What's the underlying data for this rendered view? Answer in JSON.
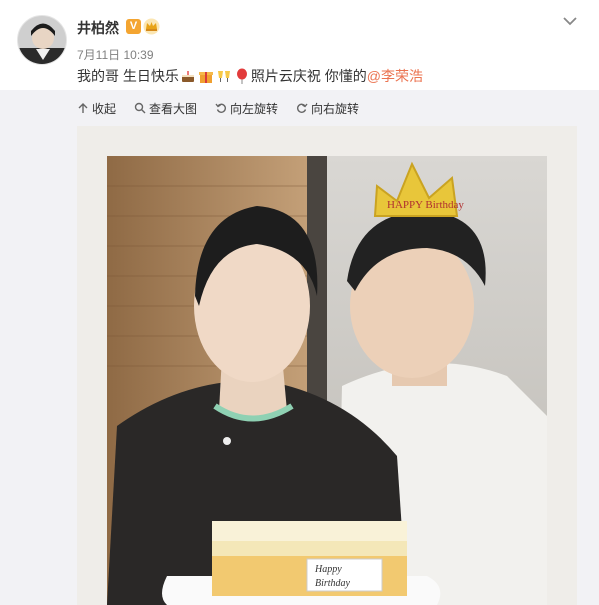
{
  "post": {
    "username": "井柏然",
    "verified_mark": "V",
    "timestamp": "7月11日 10:39",
    "text_part1": "我的哥 生日快乐",
    "text_part2": " 照片云庆祝 你懂的",
    "mention": "@李荣浩",
    "emojis": [
      "cake-icon",
      "gift-icon",
      "cheers-icon",
      "balloon-icon"
    ]
  },
  "toolbar": {
    "collapse": "收起",
    "view_large": "查看大图",
    "rotate_left": "向左旋转",
    "rotate_right": "向右旋转"
  },
  "photo": {
    "crown_text": "HAPPY Birthday",
    "card_line1": "Happy",
    "card_line2": "Birthday"
  },
  "colors": {
    "mention": "#eb7350",
    "verified": "#f4a531",
    "panel": "#f2f2f5"
  }
}
